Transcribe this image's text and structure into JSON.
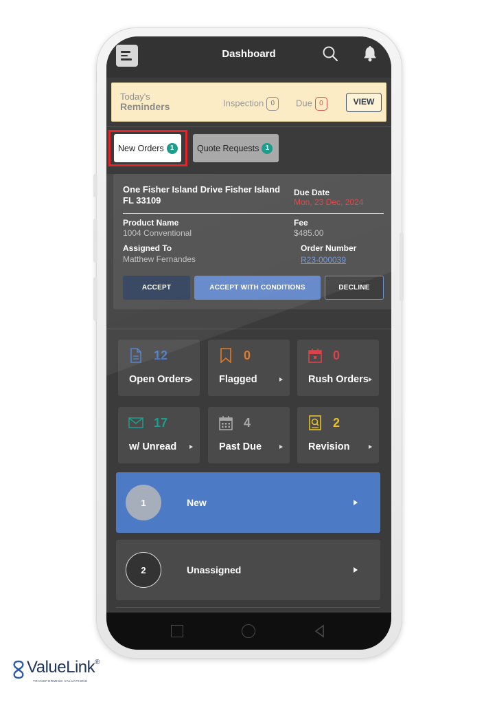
{
  "header": {
    "title": "Dashboard"
  },
  "reminders": {
    "label_line1": "Today's",
    "label_line2": "Reminders",
    "inspection_label": "Inspection",
    "inspection_count": "0",
    "due_label": "Due",
    "due_count": "0",
    "view_label": "VIEW"
  },
  "tabs": [
    {
      "label": "New Orders",
      "count": "1"
    },
    {
      "label": "Quote Requests",
      "count": "1"
    }
  ],
  "order": {
    "address": "One Fisher Island Drive Fisher Island FL 33109",
    "due_date_label": "Due Date",
    "due_date": "Mon, 23 Dec, 2024",
    "product_name_label": "Product Name",
    "product_name": "1004 Conventional",
    "fee_label": "Fee",
    "fee": "$485.00",
    "assigned_to_label": "Assigned To",
    "assigned_to": "Matthew Fernandes",
    "order_number_label": "Order Number",
    "order_number": "R23-000039",
    "accept_label": "ACCEPT",
    "accept_conditions_label": "ACCEPT WITH CONDITIONS",
    "decline_label": "DECLINE"
  },
  "tiles": [
    {
      "label": "Open Orders",
      "count": "12",
      "color": "#4f7cc4",
      "icon": "document-icon"
    },
    {
      "label": "Flagged",
      "count": "0",
      "color": "#e07b2a",
      "icon": "bookmark-icon"
    },
    {
      "label": "Rush Orders",
      "count": "0",
      "color": "#d9434a",
      "icon": "calendar-icon"
    },
    {
      "label": "w/ Unread",
      "count": "17",
      "color": "#1e9c8c",
      "icon": "envelope-icon"
    },
    {
      "label": "Past Due",
      "count": "4",
      "color": "#a8a8a8",
      "icon": "calendar-grid-icon"
    },
    {
      "label": "Revision",
      "count": "2",
      "color": "#e8c12a",
      "icon": "search-document-icon"
    }
  ],
  "rows": [
    {
      "number": "1",
      "label": "New"
    },
    {
      "number": "2",
      "label": "Unassigned"
    }
  ],
  "brand": {
    "name": "ValueLink",
    "registered": "®",
    "tagline": "TRANSFORMING VALUATIONS"
  },
  "colors": {
    "accent_blue": "#4c7ac4",
    "badge_teal": "#1e9c8c",
    "alert_red": "#e2393d",
    "highlight_red": "#e2262b",
    "reminder_bg": "#fbecc6"
  }
}
